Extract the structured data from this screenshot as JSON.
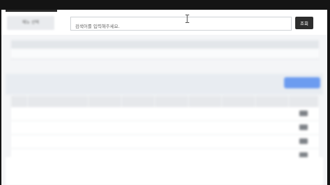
{
  "topbar": {
    "menu_label": "메뉴 선택",
    "search_placeholder": "검색어를 입력해주세요.",
    "search_button": "조회"
  },
  "summary": {
    "headers": [
      "",
      "",
      "",
      "",
      "",
      ""
    ],
    "values": [
      "",
      "",
      "",
      "",
      "",
      ""
    ]
  },
  "section": {
    "title": "",
    "button_label": ""
  },
  "table": {
    "headers": [
      "",
      "",
      "",
      "",
      "",
      "",
      "",
      "",
      ""
    ],
    "rows": [
      {
        "num": "",
        "name": "",
        "code": "",
        "c1": "",
        "c2": "",
        "c3": "",
        "c4": "",
        "c5": "",
        "action": ""
      },
      {
        "num": "",
        "name": "",
        "code": "",
        "c1": "",
        "c2": "",
        "c3": "",
        "c4": "",
        "c5": "",
        "action": ""
      },
      {
        "num": "",
        "name": "",
        "code": "",
        "c1": "",
        "c2": "",
        "c3": "",
        "c4": "",
        "c5": "",
        "action": ""
      },
      {
        "num": "",
        "name": "",
        "code": "",
        "c1": "",
        "c2": "",
        "c3": "",
        "c4": "",
        "c5": "",
        "action": ""
      }
    ]
  }
}
